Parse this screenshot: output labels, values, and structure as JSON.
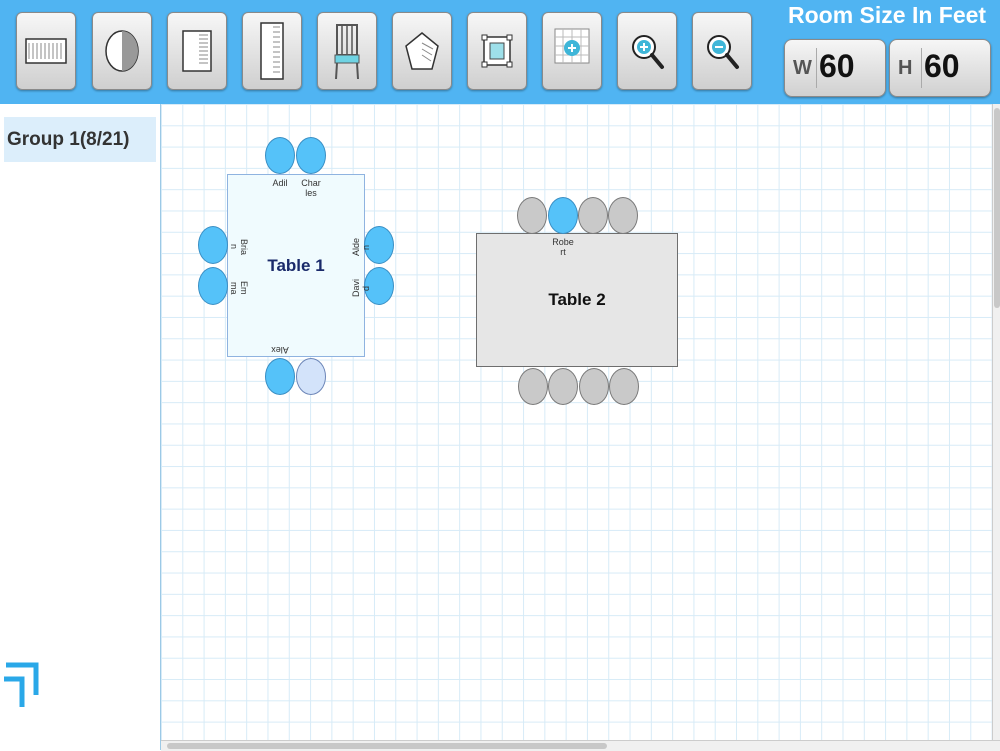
{
  "toolbar": {
    "tools": [
      {
        "name": "rectangle-table-icon"
      },
      {
        "name": "round-table-icon"
      },
      {
        "name": "square-table-icon"
      },
      {
        "name": "long-table-icon"
      },
      {
        "name": "chair-icon"
      },
      {
        "name": "pentagon-icon"
      },
      {
        "name": "fit-to-screen-icon"
      },
      {
        "name": "grid-zoom-icon"
      },
      {
        "name": "zoom-in-icon"
      },
      {
        "name": "zoom-out-icon"
      }
    ],
    "room_size_title": "Room Size In Feet",
    "width_label": "W",
    "width_value": "60",
    "height_label": "H",
    "height_value": "60"
  },
  "sidebar": {
    "group_label": "Group 1(8/21)"
  },
  "canvas": {
    "tables": [
      {
        "label": "Table 1",
        "guests": {
          "top_left": "Adil",
          "top_right": "Char\nles",
          "left_top": "Bria\nn",
          "left_bottom": "Em\nma",
          "right_top": "Alde\nn",
          "right_bottom": "Davi\nd",
          "bottom_left": "Alex"
        }
      },
      {
        "label": "Table 2",
        "guests": {
          "top_2": "Robe\nrt"
        }
      }
    ]
  },
  "colors": {
    "toolbar_bg": "#50b4f2",
    "seat_assigned": "#55c2f9",
    "seat_open": "#d3e3fa",
    "seat_inactive": "#c9c9c9"
  }
}
